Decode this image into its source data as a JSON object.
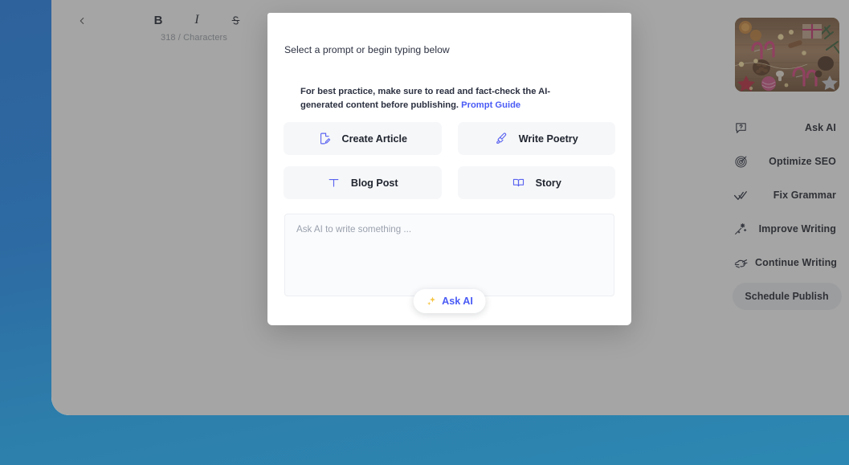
{
  "window": {
    "back_icon": "chevron-left-icon"
  },
  "toolbar": {
    "bold_label": "B",
    "italic_label": "I",
    "strikethrough_label": "S",
    "link_icon": "link-icon",
    "character_count": "318 / Characters"
  },
  "sidebar": {
    "preview_image_alt": "christmas-flatlay-photo",
    "actions": [
      {
        "label": "Ask AI",
        "icon": "chat-question-icon"
      },
      {
        "label": "Optimize SEO",
        "icon": "target-icon"
      },
      {
        "label": "Fix Grammar",
        "icon": "double-check-icon"
      },
      {
        "label": "Improve Writing",
        "icon": "magic-wand-icon"
      },
      {
        "label": "Continue Writing",
        "icon": "writing-hand-icon"
      }
    ],
    "schedule_publish_label": "Schedule Publish"
  },
  "modal": {
    "title": "Select a prompt or begin typing below",
    "notice_text": "For best practice, make sure to read and fact-check the AI-generated content before publishing.",
    "notice_link": "Prompt Guide",
    "prompts": [
      {
        "label": "Create Article",
        "icon": "file-pencil-icon"
      },
      {
        "label": "Write Poetry",
        "icon": "paintbrush-icon"
      },
      {
        "label": "Blog Post",
        "icon": "text-t-icon"
      },
      {
        "label": "Story",
        "icon": "open-book-icon"
      }
    ],
    "textarea_placeholder": "Ask AI to write something ...",
    "textarea_value": "",
    "submit_label": "Ask AI",
    "submit_icon": "sparkles-icon"
  },
  "colors": {
    "accent_blue": "#4a5bf5",
    "sparkle_gold": "#f5c542",
    "desktop_top": "#2e629c",
    "desktop_bottom": "#2c88b2"
  }
}
